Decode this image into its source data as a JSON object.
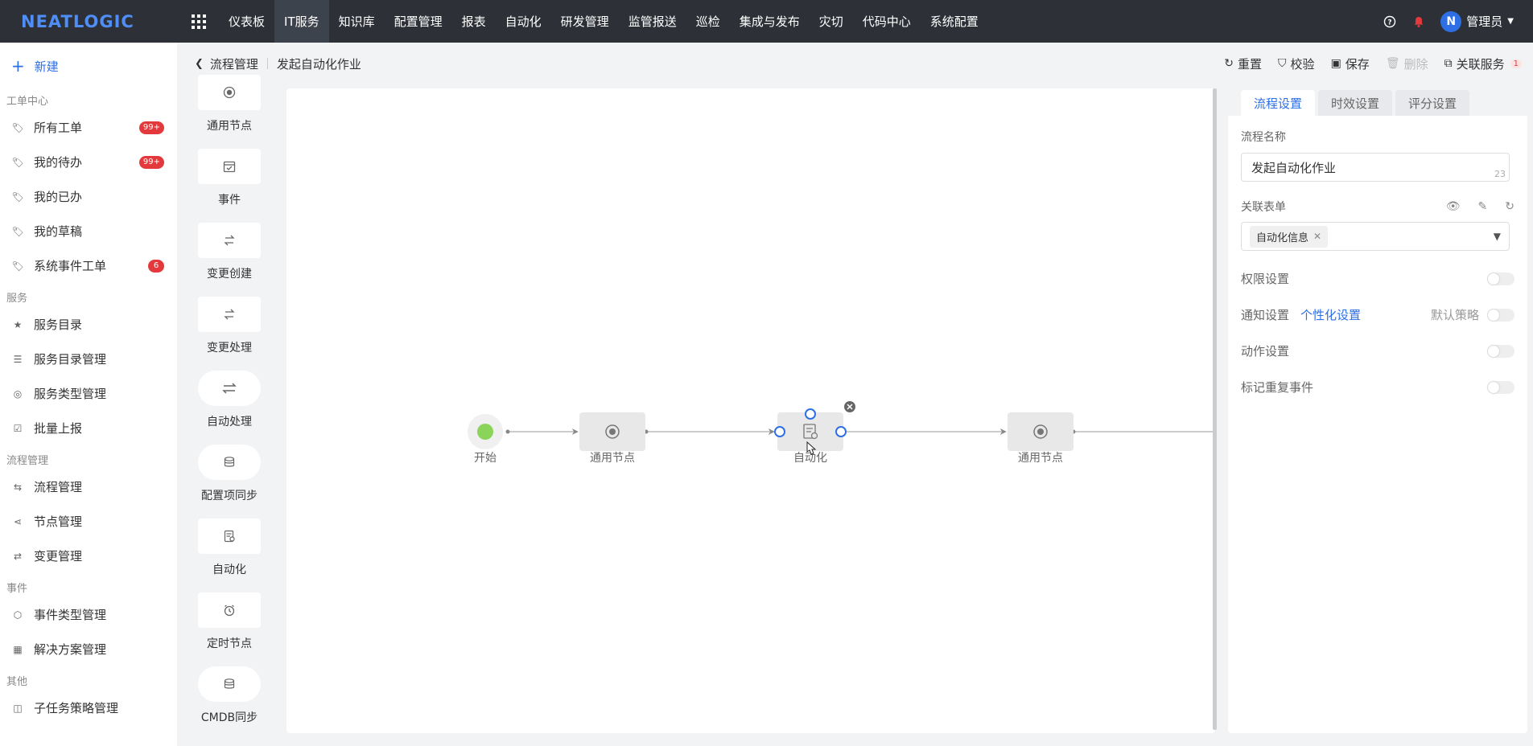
{
  "app": {
    "logo": "NEATLOGIC",
    "menu": [
      "仪表板",
      "IT服务",
      "知识库",
      "配置管理",
      "报表",
      "自动化",
      "研发管理",
      "监管报送",
      "巡检",
      "集成与发布",
      "灾切",
      "代码中心",
      "系统配置"
    ],
    "active_menu": "IT服务",
    "user_name": "管理员",
    "avatar_letter": "N"
  },
  "sidebar": {
    "new_label": "新建",
    "groups": [
      {
        "title": "工单中心",
        "items": [
          {
            "label": "所有工单",
            "badge": "99+",
            "icon": "tag-icon"
          },
          {
            "label": "我的待办",
            "badge": "99+",
            "icon": "tag-icon"
          },
          {
            "label": "我的已办",
            "badge": "",
            "icon": "tag-icon"
          },
          {
            "label": "我的草稿",
            "badge": "",
            "icon": "tag-icon"
          },
          {
            "label": "系统事件工单",
            "badge": "6",
            "icon": "tag-icon"
          }
        ]
      },
      {
        "title": "服务",
        "items": [
          {
            "label": "服务目录",
            "badge": "",
            "icon": "star-icon"
          },
          {
            "label": "服务目录管理",
            "badge": "",
            "icon": "list-icon"
          },
          {
            "label": "服务类型管理",
            "badge": "",
            "icon": "circle-icon"
          },
          {
            "label": "批量上报",
            "badge": "",
            "icon": "report-icon"
          }
        ]
      },
      {
        "title": "流程管理",
        "items": [
          {
            "label": "流程管理",
            "badge": "",
            "icon": "flow-icon"
          },
          {
            "label": "节点管理",
            "badge": "",
            "icon": "share-icon"
          },
          {
            "label": "变更管理",
            "badge": "",
            "icon": "swap-icon"
          }
        ]
      },
      {
        "title": "事件",
        "items": [
          {
            "label": "事件类型管理",
            "badge": "",
            "icon": "hexagon-icon"
          },
          {
            "label": "解决方案管理",
            "badge": "",
            "icon": "calendar-icon"
          }
        ]
      },
      {
        "title": "其他",
        "items": [
          {
            "label": "子任务策略管理",
            "badge": "",
            "icon": "task-icon"
          }
        ]
      }
    ]
  },
  "breadcrumb": {
    "parent": "流程管理",
    "current": "发起自动化作业"
  },
  "toolbar": {
    "reset": "重置",
    "validate": "校验",
    "save": "保存",
    "delete": "删除",
    "related": "关联服务",
    "related_count": "1"
  },
  "palette": [
    {
      "label": "通用节点",
      "icon": "radio-icon",
      "round": false
    },
    {
      "label": "事件",
      "icon": "calendar-check-icon",
      "round": false
    },
    {
      "label": "变更创建",
      "icon": "swap-icon",
      "round": false
    },
    {
      "label": "变更处理",
      "icon": "swap-icon",
      "round": false
    },
    {
      "label": "自动处理",
      "icon": "arrows-icon",
      "round": true
    },
    {
      "label": "配置项同步",
      "icon": "database-icon",
      "round": true
    },
    {
      "label": "自动化",
      "icon": "doc-gear-icon",
      "round": false
    },
    {
      "label": "定时节点",
      "icon": "clock-icon",
      "round": false
    },
    {
      "label": "CMDB同步",
      "icon": "database-icon",
      "round": true
    }
  ],
  "flow": {
    "nodes": [
      {
        "label": "开始",
        "kind": "start"
      },
      {
        "label": "通用节点",
        "kind": "general"
      },
      {
        "label": "自动化",
        "kind": "automation",
        "selected": true
      },
      {
        "label": "通用节点",
        "kind": "general"
      }
    ]
  },
  "panel": {
    "tabs": [
      "流程设置",
      "时效设置",
      "评分设置"
    ],
    "active_tab": "流程设置",
    "name_label": "流程名称",
    "name_value": "发起自动化作业",
    "name_count": "23",
    "form_label": "关联表单",
    "form_tag": "自动化信息",
    "permission_label": "权限设置",
    "notify_label": "通知设置",
    "notify_link": "个性化设置",
    "notify_default": "默认策略",
    "action_label": "动作设置",
    "repeat_label": "标记重复事件"
  },
  "colors": {
    "accent": "#2e6fe6",
    "topnav": "#2d3137",
    "start_node": "#8bd45a",
    "badge": "#e4393c"
  }
}
